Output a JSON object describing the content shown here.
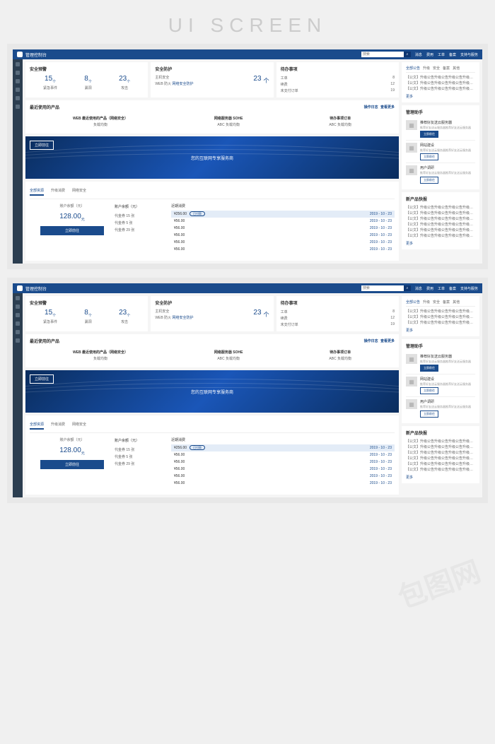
{
  "page_label": "UI SCREEN",
  "topbar": {
    "title": "管理控制台",
    "search_placeholder": "搜索",
    "links": [
      "消息",
      "费用",
      "工单",
      "备案",
      "支持与服务"
    ]
  },
  "security_alert": {
    "title": "安全预警",
    "stats": [
      {
        "value": "15",
        "unit": "个",
        "label": "紧急事件"
      },
      {
        "value": "8",
        "unit": "个",
        "label": "漏洞"
      },
      {
        "value": "23",
        "unit": "个",
        "label": "攻击"
      }
    ]
  },
  "security_defense": {
    "title": "安全防护",
    "host_label": "主机安全",
    "web_label": "WEB 防火",
    "link": "网络安全防护",
    "value": "23",
    "unit": "个"
  },
  "todo": {
    "title": "待办事项",
    "items": [
      {
        "label": "工单",
        "value": "8"
      },
      {
        "label": "续费",
        "value": "12"
      },
      {
        "label": "未支付订单",
        "value": "19"
      }
    ]
  },
  "recent_products": {
    "title": "最近使用的产品",
    "log_link": "操作日志",
    "more_link": "查看更多",
    "cols": [
      {
        "name": "WEB 最近使用的产品（网络安全）",
        "sub": "负载均衡"
      },
      {
        "name": "网络服务器 SOHE",
        "sub": "ABC 负载均衡"
      },
      {
        "name": "待办事项订单",
        "sub": "ABC 负载均衡"
      }
    ]
  },
  "banner": {
    "button": "立即前往",
    "text": "您的互联网专享服务商"
  },
  "resource_tabs": [
    "全部资源",
    "升级消费",
    "网络安全"
  ],
  "balance": {
    "label": "账户余额（元）",
    "amount": "128.00",
    "unit": "元",
    "button": "立即前往"
  },
  "balance_mid": {
    "head": "账户余额（元）",
    "lines": [
      "代金券 15 张",
      "代金券 5 张",
      "代金券 29 张"
    ]
  },
  "consume": {
    "title": "近期消费",
    "rows": [
      {
        "amount": "¥256.00",
        "badge": "已付款",
        "date": "2019 - 10 - 23",
        "hl": true
      },
      {
        "amount": "¥56.00",
        "date": "2019 - 10 - 23"
      },
      {
        "amount": "¥56.00",
        "date": "2019 - 10 - 23"
      },
      {
        "amount": "¥56.00",
        "date": "2019 - 10 - 23"
      },
      {
        "amount": "¥56.00",
        "date": "2019 - 10 - 23"
      },
      {
        "amount": "¥56.00",
        "date": "2019 - 10 - 23"
      }
    ]
  },
  "announcements": {
    "tabs": [
      "全部公告",
      "升级",
      "安全",
      "备案",
      "其他"
    ],
    "items": [
      "【公文】升级公告升级公告升级公告升级公告",
      "【公文】升级公告升级公告升级公告升级公告",
      "【公文】升级公告升级公告升级公告升级公告"
    ],
    "more": "更多"
  },
  "helper": {
    "title": "管理助手",
    "cards": [
      {
        "title": "推荐好友送云服务器",
        "desc": "推荐好友送云服务器推荐好友送云服务器",
        "btn": "立即前往",
        "solid": true
      },
      {
        "title": "网站建设",
        "desc": "推荐好友送云服务器推荐好友送云服务器",
        "btn": "立即前往"
      },
      {
        "title": "用户调研",
        "desc": "推荐好友送云服务器推荐好友送云服务器",
        "btn": "立即前往"
      }
    ]
  },
  "new_products": {
    "title": "新产品快报",
    "items": [
      "【公文】升级公告升级公告升级公告升级公告",
      "【公文】升级公告升级公告升级公告升级公告",
      "【公文】升级公告升级公告升级公告升级公告",
      "【公文】升级公告升级公告升级公告升级公告",
      "【公文】升级公告升级公告升级公告升级公告",
      "【公文】升级公告升级公告升级公告升级公告"
    ],
    "more": "更多"
  },
  "watermark": "包图网"
}
